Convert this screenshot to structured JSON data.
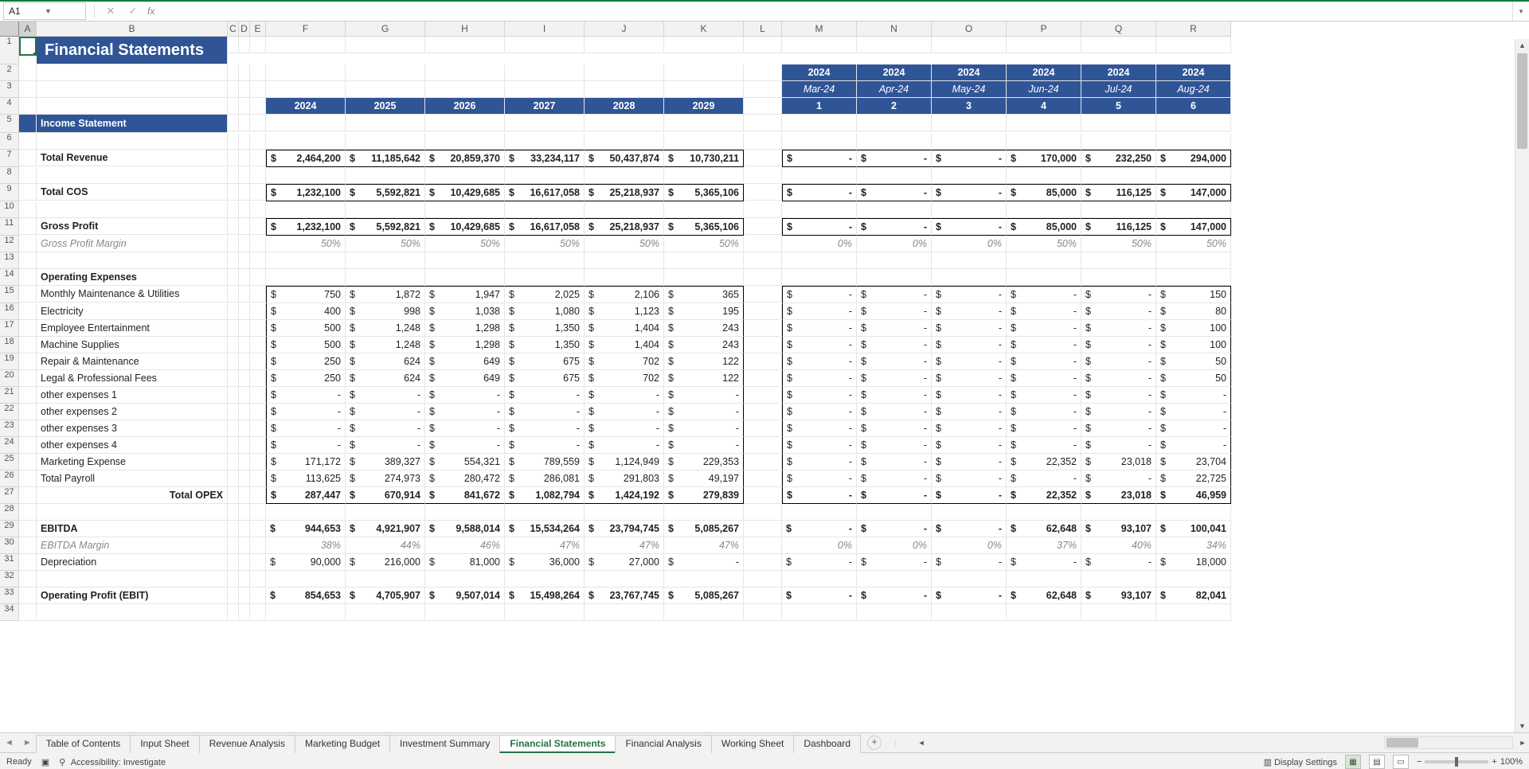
{
  "namebox": "A1",
  "fx": "fx",
  "title": "Financial Statements",
  "colHdr": [
    "A",
    "B",
    "C",
    "D",
    "E",
    "F",
    "G",
    "H",
    "I",
    "J",
    "K",
    "L",
    "M",
    "N",
    "O",
    "P",
    "Q",
    "R"
  ],
  "rowHdr": [
    "1",
    "2",
    "3",
    "4",
    "5",
    "6",
    "7",
    "8",
    "9",
    "10",
    "11",
    "12",
    "13",
    "14",
    "15",
    "16",
    "17",
    "18",
    "19",
    "20",
    "21",
    "22",
    "23",
    "24",
    "25",
    "26",
    "27",
    "28",
    "29",
    "30",
    "31",
    "32",
    "33",
    "34"
  ],
  "annualYears": [
    "2024",
    "2025",
    "2026",
    "2027",
    "2028",
    "2029"
  ],
  "monthYears": [
    "2024",
    "2024",
    "2024",
    "2024",
    "2024",
    "2024"
  ],
  "monthNames": [
    "Mar-24",
    "Apr-24",
    "May-24",
    "Jun-24",
    "Jul-24",
    "Aug-24"
  ],
  "monthNums": [
    "1",
    "2",
    "3",
    "4",
    "5",
    "6"
  ],
  "section": "Income Statement",
  "labels": {
    "totalRevenue": "Total Revenue",
    "totalCOS": "Total COS",
    "grossProfit": "Gross Profit",
    "grossMargin": "Gross Profit Margin",
    "opex": "Operating Expenses",
    "maint": "Monthly Maintenance & Utilities",
    "elec": "Electricity",
    "empEnt": "Employee Entertainment",
    "machSup": "Machine Supplies",
    "repMaint": "Repair & Maintenance",
    "legal": "Legal & Professional Fees",
    "oe1": "other expenses 1",
    "oe2": "other expenses 2",
    "oe3": "other expenses 3",
    "oe4": "other expenses 4",
    "mktExp": "Marketing Expense",
    "payroll": "Total Payroll",
    "totalOpex": "Total OPEX",
    "ebitda": "EBITDA",
    "ebitdaMargin": "EBITDA Margin",
    "depr": "Depreciation",
    "ebit": "Operating Profit (EBIT)"
  },
  "annual": {
    "revenue": [
      "2,464,200",
      "11,185,642",
      "20,859,370",
      "33,234,117",
      "50,437,874",
      "10,730,211"
    ],
    "cos": [
      "1,232,100",
      "5,592,821",
      "10,429,685",
      "16,617,058",
      "25,218,937",
      "5,365,106"
    ],
    "grossProfit": [
      "1,232,100",
      "5,592,821",
      "10,429,685",
      "16,617,058",
      "25,218,937",
      "5,365,106"
    ],
    "grossMargin": [
      "50%",
      "50%",
      "50%",
      "50%",
      "50%",
      "50%"
    ],
    "maint": [
      "750",
      "1,872",
      "1,947",
      "2,025",
      "2,106",
      "365"
    ],
    "elec": [
      "400",
      "998",
      "1,038",
      "1,080",
      "1,123",
      "195"
    ],
    "empEnt": [
      "500",
      "1,248",
      "1,298",
      "1,350",
      "1,404",
      "243"
    ],
    "machSup": [
      "500",
      "1,248",
      "1,298",
      "1,350",
      "1,404",
      "243"
    ],
    "repMaint": [
      "250",
      "624",
      "649",
      "675",
      "702",
      "122"
    ],
    "legal": [
      "250",
      "624",
      "649",
      "675",
      "702",
      "122"
    ],
    "oe1": [
      "-",
      "-",
      "-",
      "-",
      "-",
      "-"
    ],
    "oe2": [
      "-",
      "-",
      "-",
      "-",
      "-",
      "-"
    ],
    "oe3": [
      "-",
      "-",
      "-",
      "-",
      "-",
      "-"
    ],
    "oe4": [
      "-",
      "-",
      "-",
      "-",
      "-",
      "-"
    ],
    "mktExp": [
      "171,172",
      "389,327",
      "554,321",
      "789,559",
      "1,124,949",
      "229,353"
    ],
    "payroll": [
      "113,625",
      "274,973",
      "280,472",
      "286,081",
      "291,803",
      "49,197"
    ],
    "totalOpex": [
      "287,447",
      "670,914",
      "841,672",
      "1,082,794",
      "1,424,192",
      "279,839"
    ],
    "ebitda": [
      "944,653",
      "4,921,907",
      "9,588,014",
      "15,534,264",
      "23,794,745",
      "5,085,267"
    ],
    "ebitdaMargin": [
      "38%",
      "44%",
      "46%",
      "47%",
      "47%",
      "47%"
    ],
    "depr": [
      "90,000",
      "216,000",
      "81,000",
      "36,000",
      "27,000",
      "-"
    ],
    "ebit": [
      "854,653",
      "4,705,907",
      "9,507,014",
      "15,498,264",
      "23,767,745",
      "5,085,267"
    ]
  },
  "monthly": {
    "revenue": [
      "-",
      "-",
      "-",
      "170,000",
      "232,250",
      "294,000"
    ],
    "cos": [
      "-",
      "-",
      "-",
      "85,000",
      "116,125",
      "147,000"
    ],
    "grossProfit": [
      "-",
      "-",
      "-",
      "85,000",
      "116,125",
      "147,000"
    ],
    "grossMargin": [
      "0%",
      "0%",
      "0%",
      "50%",
      "50%",
      "50%"
    ],
    "maint": [
      "-",
      "-",
      "-",
      "-",
      "-",
      "150"
    ],
    "elec": [
      "-",
      "-",
      "-",
      "-",
      "-",
      "80"
    ],
    "empEnt": [
      "-",
      "-",
      "-",
      "-",
      "-",
      "100"
    ],
    "machSup": [
      "-",
      "-",
      "-",
      "-",
      "-",
      "100"
    ],
    "repMaint": [
      "-",
      "-",
      "-",
      "-",
      "-",
      "50"
    ],
    "legal": [
      "-",
      "-",
      "-",
      "-",
      "-",
      "50"
    ],
    "oe1": [
      "-",
      "-",
      "-",
      "-",
      "-",
      "-"
    ],
    "oe2": [
      "-",
      "-",
      "-",
      "-",
      "-",
      "-"
    ],
    "oe3": [
      "-",
      "-",
      "-",
      "-",
      "-",
      "-"
    ],
    "oe4": [
      "-",
      "-",
      "-",
      "-",
      "-",
      "-"
    ],
    "mktExp": [
      "-",
      "-",
      "-",
      "22,352",
      "23,018",
      "23,704"
    ],
    "payroll": [
      "-",
      "-",
      "-",
      "-",
      "-",
      "22,725"
    ],
    "totalOpex": [
      "-",
      "-",
      "-",
      "22,352",
      "23,018",
      "46,959"
    ],
    "ebitda": [
      "-",
      "-",
      "-",
      "62,648",
      "93,107",
      "100,041"
    ],
    "ebitdaMargin": [
      "0%",
      "0%",
      "0%",
      "37%",
      "40%",
      "34%"
    ],
    "depr": [
      "-",
      "-",
      "-",
      "-",
      "-",
      "18,000"
    ],
    "ebit": [
      "-",
      "-",
      "-",
      "62,648",
      "93,107",
      "82,041"
    ]
  },
  "tabs": [
    "Table of Contents",
    "Input Sheet",
    "Revenue Analysis",
    "Marketing Budget",
    "Investment Summary",
    "Financial Statements",
    "Financial Analysis",
    "Working Sheet",
    "Dashboard"
  ],
  "activeTab": "Financial Statements",
  "status": {
    "ready": "Ready",
    "acc": "Accessibility: Investigate",
    "disp": "Display Settings",
    "zoom": "100%"
  }
}
